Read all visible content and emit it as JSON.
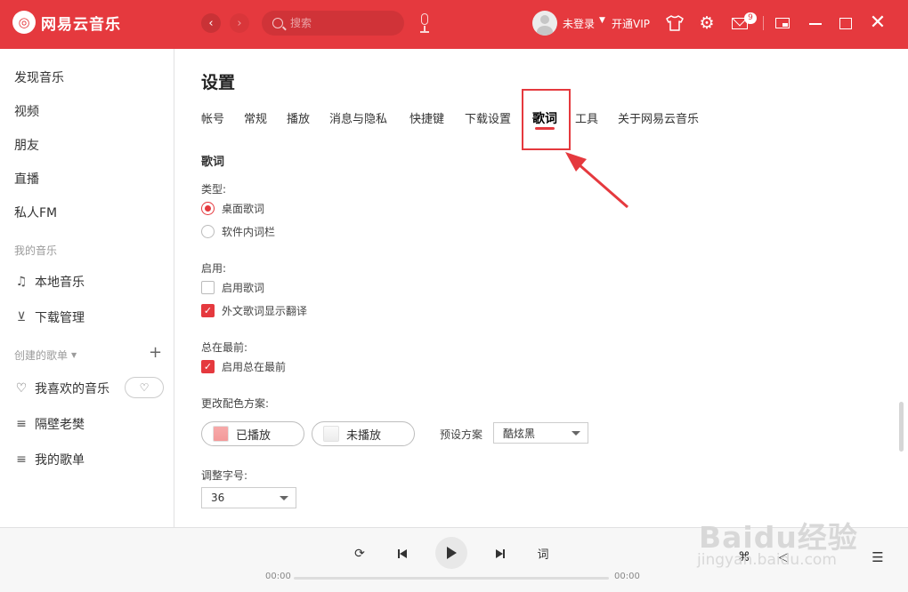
{
  "header": {
    "app_name": "网易云音乐",
    "search_placeholder": "搜索",
    "user_status": "未登录",
    "vip_label": "开通VIP",
    "mail_badge": "9",
    "accent_color": "#e5393e"
  },
  "sidebar": {
    "items": [
      "发现音乐",
      "视频",
      "朋友",
      "直播",
      "私人FM"
    ],
    "my_music_header": "我的音乐",
    "my_music_items": [
      "本地音乐",
      "下载管理"
    ],
    "created_playlists_header": "创建的歌单",
    "playlists": [
      "我喜欢的音乐",
      "隔壁老樊",
      "我的歌单"
    ]
  },
  "settings": {
    "title": "设置",
    "tabs": [
      "帐号",
      "常规",
      "播放",
      "消息与隐私",
      "快捷键",
      "下载设置",
      "歌词",
      "工具",
      "关于网易云音乐"
    ],
    "active_tab": "歌词",
    "section_title": "歌词",
    "type_label": "类型:",
    "type_options": [
      "桌面歌词",
      "软件内词栏"
    ],
    "enable_label": "启用:",
    "enable_options": [
      "启用歌词",
      "外文歌词显示翻译"
    ],
    "on_top_label": "总在最前:",
    "on_top_option": "启用总在最前",
    "color_label": "更改配色方案:",
    "played_button": "已播放",
    "unplayed_button": "未播放",
    "preset_label": "预设方案",
    "preset_value": "酷炫黑",
    "font_size_label": "调整字号:",
    "font_size_value": "36"
  },
  "player": {
    "lyric_button": "词",
    "current_time": "00:00",
    "total_time": "00:00",
    "progress": 0
  },
  "watermark": {
    "brand": "Baidu经验",
    "url": "jingyan.baidu.com"
  }
}
